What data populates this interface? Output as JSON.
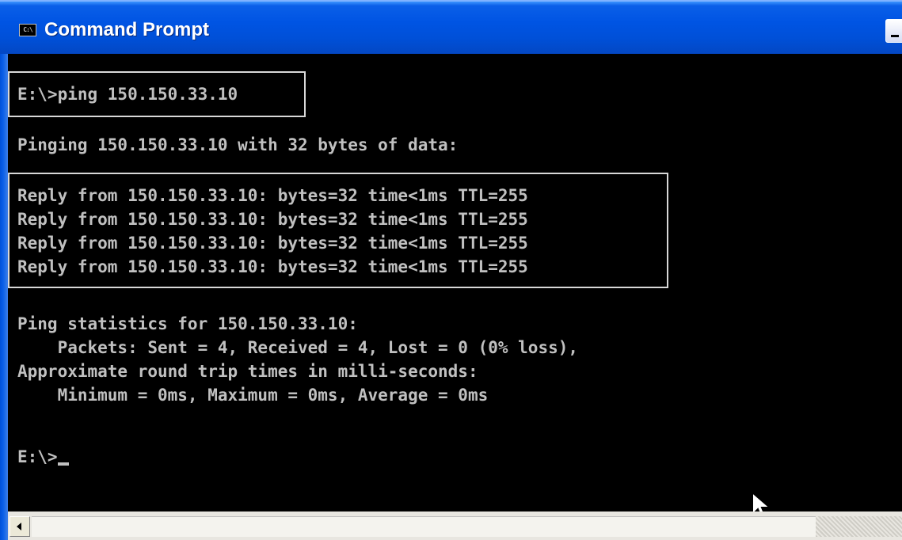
{
  "window": {
    "title": "Command Prompt",
    "icon_label": "C:\\"
  },
  "console": {
    "lines": [
      "E:\\>ping 150.150.33.10",
      "Pinging 150.150.33.10 with 32 bytes of data:",
      "Reply from 150.150.33.10: bytes=32 time<1ms TTL=255",
      "Reply from 150.150.33.10: bytes=32 time<1ms TTL=255",
      "Reply from 150.150.33.10: bytes=32 time<1ms TTL=255",
      "Reply from 150.150.33.10: bytes=32 time<1ms TTL=255",
      "Ping statistics for 150.150.33.10:",
      "    Packets: Sent = 4, Received = 4, Lost = 0 (0% loss),",
      "Approximate round trip times in milli-seconds:",
      "    Minimum = 0ms, Maximum = 0ms, Average = 0ms",
      "E:\\>"
    ]
  },
  "colors": {
    "console_bg": "#000000",
    "console_fg": "#c0c0c0",
    "titlebar": "#0054e3"
  }
}
